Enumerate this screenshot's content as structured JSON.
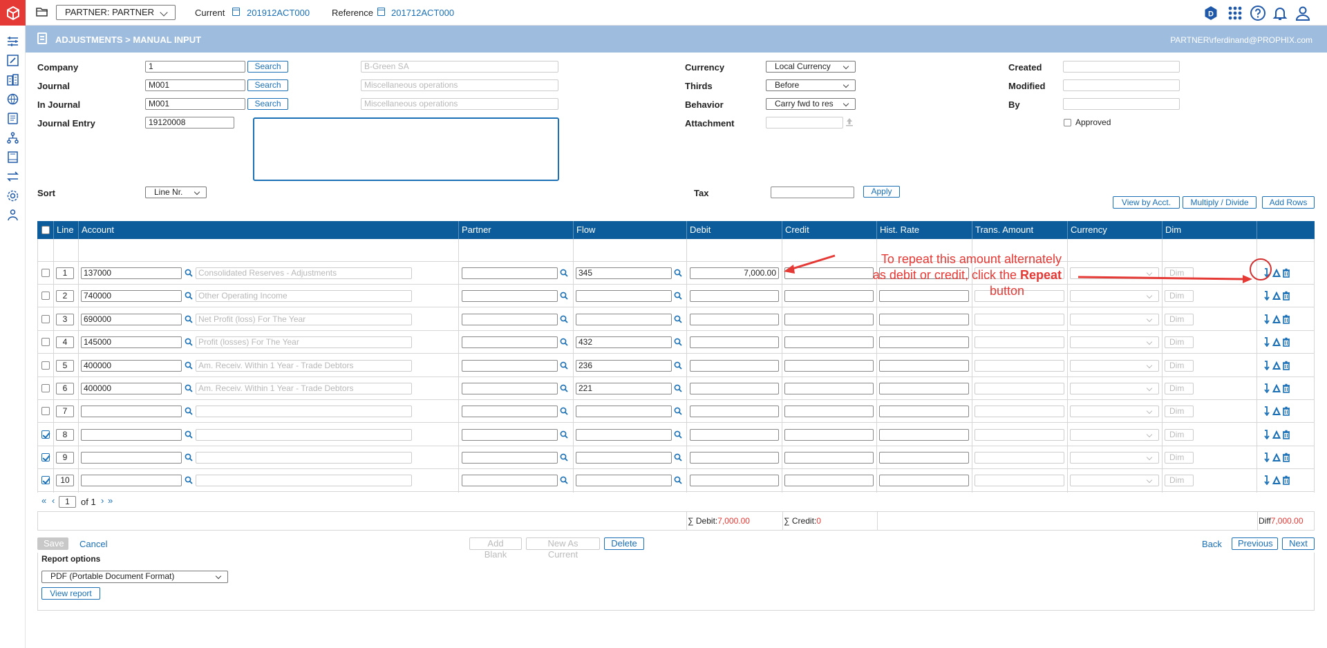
{
  "topbar": {
    "partner_select": "PARTNER: PARTNER",
    "current_label": "Current",
    "current_value": "201912ACT000",
    "reference_label": "Reference",
    "reference_value": "201712ACT000",
    "user_badge": "D"
  },
  "header": {
    "title": "ADJUSTMENTS > MANUAL INPUT",
    "user": "PARTNER\\rferdinand@PROPHIX.com"
  },
  "form": {
    "company_label": "Company",
    "company_value": "1",
    "company_desc": "B-Green SA",
    "journal_label": "Journal",
    "journal_value": "M001",
    "journal_desc": "Miscellaneous operations",
    "in_journal_label": "In Journal",
    "in_journal_value": "M001",
    "in_journal_desc": "Miscellaneous operations",
    "journal_entry_label": "Journal Entry",
    "journal_entry_value": "19120008",
    "search_label": "Search",
    "currency_label": "Currency",
    "currency_value": "Local Currency",
    "thirds_label": "Thirds",
    "thirds_value": "Before",
    "behavior_label": "Behavior",
    "behavior_value": "Carry fwd to res",
    "attachment_label": "Attachment",
    "created_label": "Created",
    "modified_label": "Modified",
    "by_label": "By",
    "approved_label": "Approved",
    "sort_label": "Sort",
    "sort_value": "Line Nr.",
    "tax_label": "Tax",
    "apply_label": "Apply",
    "view_by_acct": "View by Acct.",
    "multiply_divide": "Multiply / Divide",
    "add_rows": "Add Rows"
  },
  "table": {
    "columns": [
      "Line",
      "Account",
      "Partner",
      "Flow",
      "Debit",
      "Credit",
      "Hist. Rate",
      "Trans. Amount",
      "Currency",
      "Dim"
    ],
    "dim_label": "Dim",
    "rows": [
      {
        "line": "1",
        "account": "137000",
        "desc": "Consolidated Reserves - Adjustments",
        "flow": "345",
        "debit": "7,000.00",
        "checked": false
      },
      {
        "line": "2",
        "account": "740000",
        "desc": "Other Operating Income",
        "flow": "",
        "debit": "",
        "checked": false
      },
      {
        "line": "3",
        "account": "690000",
        "desc": "Net Profit (loss) For The Year",
        "flow": "",
        "debit": "",
        "checked": false
      },
      {
        "line": "4",
        "account": "145000",
        "desc": "Profit (losses) For The Year",
        "flow": "432",
        "debit": "",
        "checked": false
      },
      {
        "line": "5",
        "account": "400000",
        "desc": "Am. Receiv. Within 1 Year - Trade Debtors",
        "flow": "236",
        "debit": "",
        "checked": false
      },
      {
        "line": "6",
        "account": "400000",
        "desc": "Am. Receiv. Within 1 Year - Trade Debtors",
        "flow": "221",
        "debit": "",
        "checked": false
      },
      {
        "line": "7",
        "account": "",
        "desc": "",
        "flow": "",
        "debit": "",
        "checked": false
      },
      {
        "line": "8",
        "account": "",
        "desc": "",
        "flow": "",
        "debit": "",
        "checked": true
      },
      {
        "line": "9",
        "account": "",
        "desc": "",
        "flow": "",
        "debit": "",
        "checked": true
      },
      {
        "line": "10",
        "account": "",
        "desc": "",
        "flow": "",
        "debit": "",
        "checked": true
      }
    ],
    "pager": {
      "page": "1",
      "of_label": "of 1"
    },
    "totals": {
      "debit_label": "∑ Debit:",
      "debit_value": "7,000.00",
      "credit_label": "∑ Credit:",
      "credit_value": "0",
      "diff_label": "Diff",
      "diff_value": "7,000.00"
    }
  },
  "actions": {
    "save": "Save",
    "cancel": "Cancel",
    "add_blank": "Add Blank",
    "new_as_current": "New As Current",
    "delete": "Delete",
    "back": "Back",
    "previous": "Previous",
    "next": "Next"
  },
  "report": {
    "label": "Report options",
    "format": "PDF (Portable Document Format)",
    "view_report": "View report"
  },
  "annotation": {
    "line1": "To repeat this amount alternately",
    "line2_prefix": "as debit or credit, click the ",
    "line2_bold": "Repeat",
    "line3": "button"
  },
  "colors": {
    "accent": "#1a6fb5",
    "header_band": "#9ebcde",
    "table_header": "#0c5c9c",
    "brand": "#e53935",
    "annotation": "#e53935"
  }
}
